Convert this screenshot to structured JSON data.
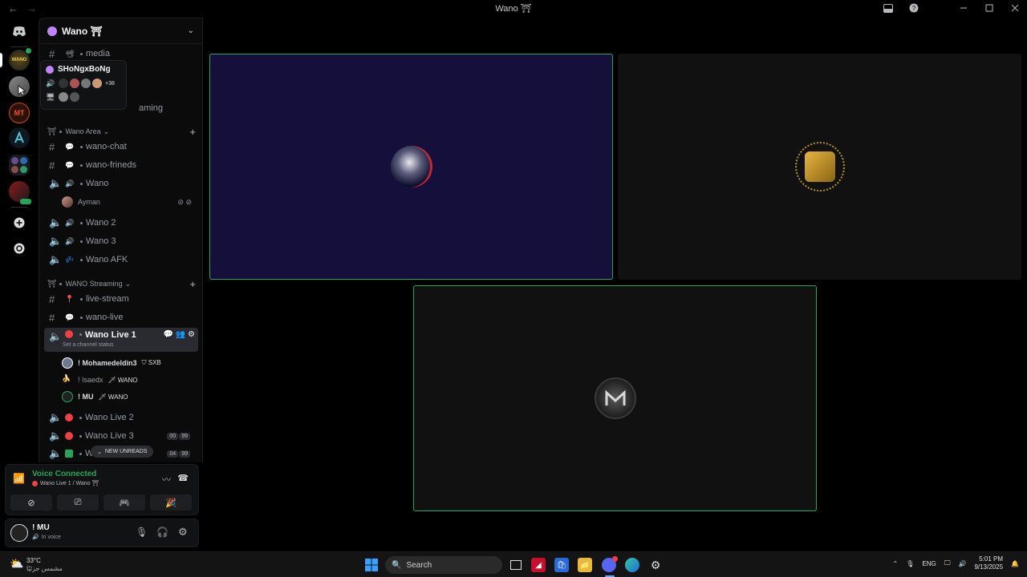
{
  "window": {
    "title": "Wano ⛩",
    "nav_back": "←",
    "nav_forward": "→"
  },
  "server": {
    "name": "Wano ⛩",
    "chevron": "⌄"
  },
  "popup": {
    "name": "SHoNgxBoNg",
    "extra_count": "+38"
  },
  "channels": {
    "media": "media",
    "gaming_partial": "aming",
    "cat_wano_area": "Wano Area",
    "wano_chat": "wano-chat",
    "wano_frineds": "wano-frineds",
    "wano_voice": "Wano",
    "ayman": "Ayman",
    "wano2": "Wano 2",
    "wano3": "Wano 3",
    "wano_afk": "Wano AFK",
    "cat_streaming": "WANO Streaming",
    "live_stream": "live-stream",
    "wano_live": "wano-live",
    "wano_live1": "Wano Live 1",
    "set_status": "Set a channel status",
    "user1": "! Mohamedeldin3",
    "user1_tag": "SXB",
    "user2": "! Isaedx",
    "user2_tag": "WANO",
    "user3": "! MU",
    "user3_tag": "WANO",
    "wano_live2": "Wano Live 2",
    "wano_live3": "Wano Live 3",
    "wano_live3_c1": "00",
    "wano_live3_c2": "99",
    "wano_live4_partial": "W",
    "wano_live4_c1": "04",
    "wano_live4_c2": "99",
    "new_unreads": "NEW UNREADS"
  },
  "voice_panel": {
    "status": "Voice Connected",
    "location": "Wano Live 1 / Wano ⛩"
  },
  "user_panel": {
    "name": "! MU",
    "status": "In voice"
  },
  "taskbar": {
    "weather_temp": "33°C",
    "weather_desc": "مشمس جزئيًا",
    "search_placeholder": "Search",
    "lang": "ENG",
    "time": "5:01 PM",
    "date": "9/13/2025"
  },
  "rail": {
    "mt_label": "MT"
  },
  "colors": {
    "speaking_border": "#23a55a",
    "tile1_bg": "#150f3b",
    "tile_dark": "#111111",
    "voice_green": "#23a55a"
  }
}
